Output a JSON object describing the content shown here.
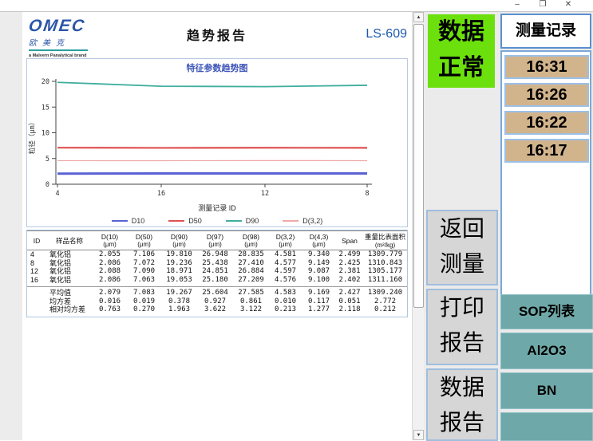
{
  "titlebar": {
    "minimize": "–",
    "maximize": "❐",
    "close": "✕"
  },
  "page": {
    "logo": {
      "name": "OMEC",
      "cn": "欧美克",
      "tagline": "a Malvern Panalytical brand"
    },
    "title": "趋势报告",
    "model": "LS-609"
  },
  "chart_data": {
    "type": "line",
    "title": "特征参数趋势图",
    "xlabel": "测量记录 ID",
    "ylabel": "粒径（μm）",
    "x_ticks": [
      "4",
      "16",
      "12",
      "8"
    ],
    "y_ticks": [
      0,
      5,
      10,
      15,
      20
    ],
    "ylim": [
      0,
      21
    ],
    "grid": false,
    "legend_position": "bottom",
    "series": [
      {
        "name": "D10",
        "color": "#5b62d4",
        "values": [
          2.055,
          2.086,
          2.088,
          2.086
        ]
      },
      {
        "name": "D50",
        "color": "#e05252",
        "values": [
          7.106,
          7.063,
          7.09,
          7.072
        ]
      },
      {
        "name": "D90",
        "color": "#3fae9f",
        "values": [
          19.81,
          19.053,
          18.971,
          19.236
        ]
      },
      {
        "name": "D(3,2)",
        "color": "#f0a8a8",
        "values": [
          4.581,
          4.576,
          4.597,
          4.577
        ]
      }
    ]
  },
  "table": {
    "headers": [
      {
        "line1": "ID",
        "line2": ""
      },
      {
        "line1": "样品名称",
        "line2": ""
      },
      {
        "line1": "D(10)",
        "line2": "(μm)"
      },
      {
        "line1": "D(50)",
        "line2": "(μm)"
      },
      {
        "line1": "D(90)",
        "line2": "(μm)"
      },
      {
        "line1": "D(97)",
        "line2": "(μm)"
      },
      {
        "line1": "D(98)",
        "line2": "(μm)"
      },
      {
        "line1": "D(3,2)",
        "line2": "(μm)"
      },
      {
        "line1": "D(4,3)",
        "line2": "(μm)"
      },
      {
        "line1": "Span",
        "line2": ""
      },
      {
        "line1": "重量比表面积",
        "line2": "(m²/kg)"
      }
    ],
    "rows": [
      [
        "4",
        "氧化铝",
        "2.055",
        "7.106",
        "19.810",
        "26.948",
        "28.835",
        "4.581",
        "9.340",
        "2.499",
        "1309.779"
      ],
      [
        "8",
        "氧化铝",
        "2.086",
        "7.072",
        "19.236",
        "25.438",
        "27.410",
        "4.577",
        "9.149",
        "2.425",
        "1310.843"
      ],
      [
        "12",
        "氧化铝",
        "2.088",
        "7.090",
        "18.971",
        "24.851",
        "26.884",
        "4.597",
        "9.087",
        "2.381",
        "1305.177"
      ],
      [
        "16",
        "氧化铝",
        "2.086",
        "7.063",
        "19.053",
        "25.180",
        "27.209",
        "4.576",
        "9.100",
        "2.402",
        "1311.160"
      ]
    ],
    "summary": [
      [
        "平均值",
        "2.079",
        "7.083",
        "19.267",
        "25.604",
        "27.585",
        "4.583",
        "9.169",
        "2.427",
        "1309.240"
      ],
      [
        "均方差",
        "0.016",
        "0.019",
        "0.378",
        "0.927",
        "0.861",
        "0.010",
        "0.117",
        "0.051",
        "2.772"
      ],
      [
        "相对均方差",
        "0.763",
        "0.270",
        "1.963",
        "3.622",
        "3.122",
        "0.213",
        "1.277",
        "2.118",
        "0.212"
      ]
    ]
  },
  "right_panel": {
    "status": {
      "line1": "数据",
      "line2": "正常",
      "bg": "#6ce00c"
    },
    "records_title": "测量记录",
    "records": [
      "16:31",
      "16:26",
      "16:22",
      "16:17"
    ],
    "actions": [
      {
        "line1": "返回",
        "line2": "测量"
      },
      {
        "line1": "打印",
        "line2": "报告"
      },
      {
        "line1": "数据",
        "line2": "报告"
      }
    ],
    "sop_buttons": [
      "SOP列表",
      "Al2O3",
      "BN",
      ""
    ]
  },
  "scrollbar": {
    "up": "▲",
    "down": "▼"
  }
}
